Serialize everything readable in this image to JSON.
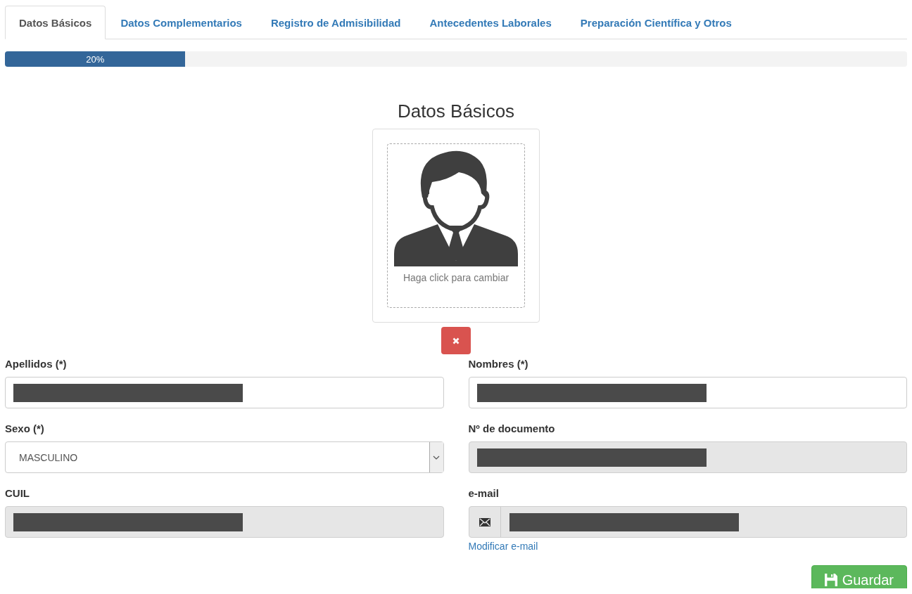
{
  "tabs": [
    {
      "label": "Datos Básicos",
      "selected": true
    },
    {
      "label": "Datos Complementarios",
      "selected": false
    },
    {
      "label": "Registro de Admisibilidad",
      "selected": false
    },
    {
      "label": "Antecedentes Laborales",
      "selected": false
    },
    {
      "label": "Preparación Científica y Otros",
      "selected": false
    }
  ],
  "progress": {
    "level": 0.2,
    "label": "20%"
  },
  "title": "Datos Básicos",
  "photo": {
    "hint": "Haga click para cambiar"
  },
  "fields": [
    {
      "label": "Apellidos (*)",
      "kind": "text",
      "disabled": false,
      "redacted": true
    },
    {
      "label": "Nombres (*)",
      "kind": "text",
      "disabled": false,
      "redacted": true
    },
    {
      "label": "Sexo (*)",
      "kind": "select",
      "value": "MASCULINO"
    },
    {
      "label": "Nº de documento",
      "kind": "text",
      "disabled": true,
      "redacted": true
    },
    {
      "label": "CUIL",
      "kind": "text",
      "disabled": true,
      "redacted": true
    },
    {
      "label": "e-mail",
      "kind": "email",
      "disabled": true,
      "redacted": true,
      "link": "Modificar e-mail"
    }
  ],
  "save_button": "Guardar"
}
